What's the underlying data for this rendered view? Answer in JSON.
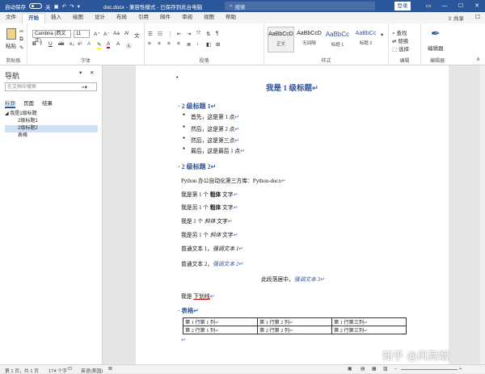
{
  "titlebar": {
    "autosave_label": "自动保存",
    "autosave_state": "关",
    "doc_name": "doc.docx",
    "mode": "兼容性模式",
    "save_status": "已保存到此台电脑",
    "search_placeholder": "搜索",
    "login": "登录"
  },
  "menu": {
    "tabs": [
      "文件",
      "开始",
      "插入",
      "绘图",
      "设计",
      "布局",
      "引用",
      "邮件",
      "审阅",
      "视图",
      "帮助"
    ],
    "share": "共享"
  },
  "ribbon": {
    "clipboard": {
      "paste": "粘贴",
      "label": "剪贴板"
    },
    "font": {
      "family": "Cambria (西文正)",
      "size": "11",
      "label": "字体"
    },
    "paragraph": {
      "label": "段落"
    },
    "styles": {
      "label": "样式",
      "items": [
        {
          "preview": "AaBbCcD",
          "name": "正文"
        },
        {
          "preview": "AaBbCcD",
          "name": "无间隔"
        },
        {
          "preview": "AaBbCc",
          "name": "标题 1"
        },
        {
          "preview": "AaBbCc",
          "name": "标题 2"
        }
      ]
    },
    "editing": {
      "find": "查找",
      "replace": "替换",
      "select": "选择",
      "label": "编辑"
    },
    "editor": {
      "name": "编辑器",
      "label": "编辑器"
    }
  },
  "nav": {
    "title": "导航",
    "search_placeholder": "在文档中搜索",
    "tabs": [
      "标题",
      "页面",
      "结果"
    ],
    "tree": [
      "我是1级标题",
      "2级标题1",
      "2级标题2",
      "表格"
    ]
  },
  "document": {
    "h1": "我是 1 级标题",
    "h2_1": "2 级标题 1",
    "bullets": [
      "首先，这是第 1 点",
      "然后，这是第 2 点",
      "然后，这是第三点",
      "最后，这是最后 1 点"
    ],
    "h2_2": "2 级标题 2",
    "para1": "Python 办公自动化第三方库：Python-docx",
    "bold_line_a": "我是第 1 个 ",
    "bold_word": "粗体",
    "bold_line_b": " 文字",
    "bold2_line_a": "我是另 1 个 ",
    "italic_line_a": "我是 1 个 ",
    "italic_word": "斜体",
    "italic2_line_a": "我是另 1 个 ",
    "normal1_a": "普通文本 1，",
    "normal1_em": "强调文本 1",
    "normal2_a": "普通文本 2，",
    "normal2_em": "强调文本 2",
    "center_a": "此段落居中，",
    "center_em": "强调文本 3",
    "underline_a": "我是 ",
    "underline_word": "下划线",
    "h_table": "表格",
    "table": [
      [
        "第 1 行第 1 列",
        "第 1 行第 2 列",
        "第 1 行第三列"
      ],
      [
        "第 2 行第 1 列",
        "第 2 行第 2 列",
        "第 2 行第三列"
      ]
    ]
  },
  "status": {
    "page": "第 1 页，共 1 页",
    "words": "174 个字",
    "lang": "英语(美国)"
  },
  "watermark": "知乎 @风舞烟"
}
